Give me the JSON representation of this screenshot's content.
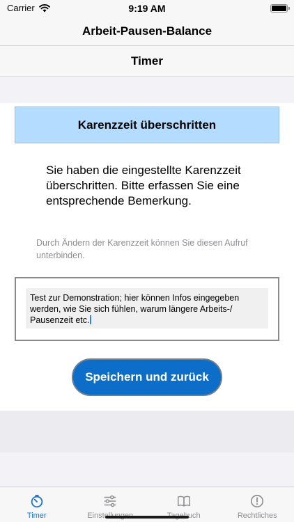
{
  "status": {
    "carrier": "Carrier",
    "time": "9:19 AM"
  },
  "nav": {
    "title": "Arbeit-Pausen-Balance"
  },
  "screen": {
    "title": "Timer"
  },
  "banner": {
    "title": "Karenzzeit überschritten"
  },
  "message": "Sie haben die eingestellte Karenzzeit überschritten. Bitte erfassen Sie eine entsprechende Bemerkung.",
  "hint": "Durch Ändern der Karenzzeit können Sie diesen Aufruf unterbinden.",
  "remark": {
    "value": "Test zur Demonstration; hier können Infos eingegeben werden, wie Sie sich fühlen, warum längere Arbeits-/ Pausenzeit etc."
  },
  "save_button": {
    "label": "Speichern und zurück"
  },
  "tabs": [
    {
      "label": "Timer",
      "icon": "timer-icon",
      "active": true
    },
    {
      "label": "Einstellungen",
      "icon": "sliders-icon",
      "active": false
    },
    {
      "label": "Tagebuch",
      "icon": "book-icon",
      "active": false
    },
    {
      "label": "Rechtliches",
      "icon": "info-circle-icon",
      "active": false
    }
  ],
  "colors": {
    "accent": "#1b74d2",
    "button": "#0c6ec8",
    "banner": "#b3dcff"
  }
}
